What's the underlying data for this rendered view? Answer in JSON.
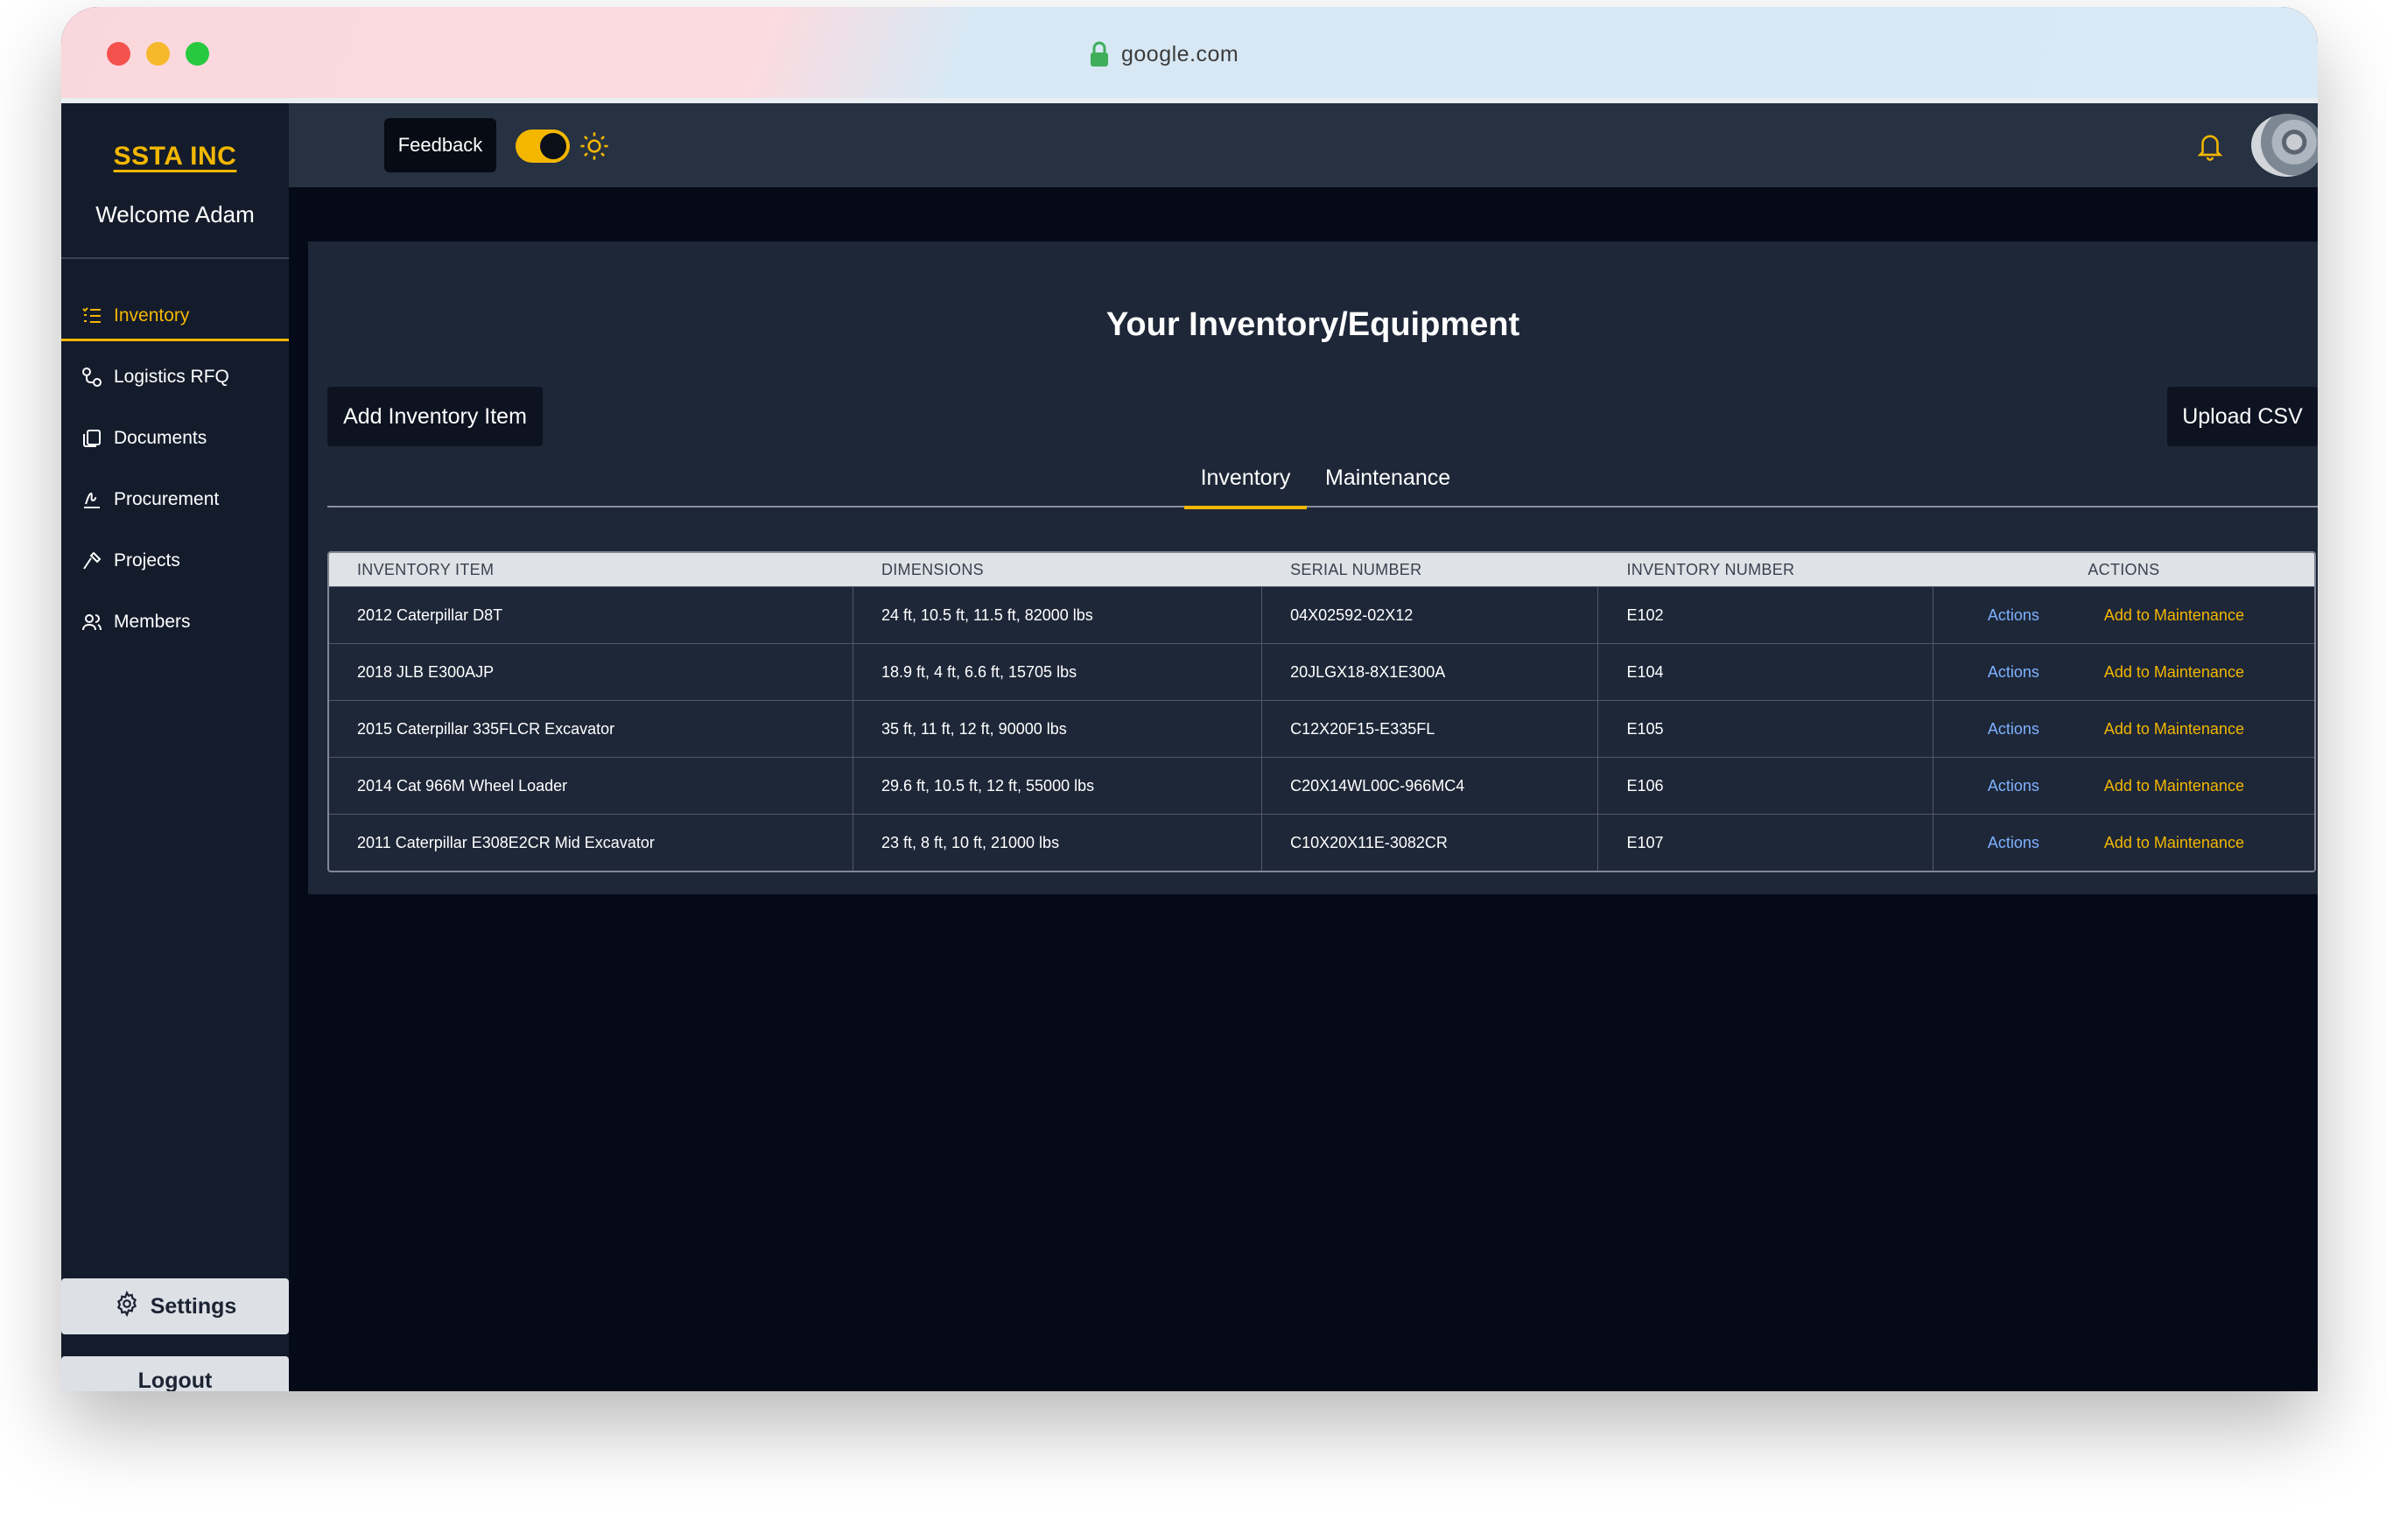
{
  "browser": {
    "url": "google.com",
    "colors": {
      "close": "#f5524e",
      "minimize": "#f6b82b",
      "maximize": "#27c93f"
    }
  },
  "sidebar": {
    "brand": "SSTA INC",
    "welcome": "Welcome Adam",
    "items": [
      {
        "label": "Inventory",
        "icon": "list-icon",
        "active": true
      },
      {
        "label": "Logistics RFQ",
        "icon": "route-icon",
        "active": false
      },
      {
        "label": "Documents",
        "icon": "documents-icon",
        "active": false
      },
      {
        "label": "Procurement",
        "icon": "signature-icon",
        "active": false
      },
      {
        "label": "Projects",
        "icon": "hammer-icon",
        "active": false
      },
      {
        "label": "Members",
        "icon": "users-icon",
        "active": false
      }
    ],
    "settings_label": "Settings",
    "logout_label": "Logout"
  },
  "header": {
    "feedback_label": "Feedback",
    "theme_toggle_on": true,
    "icons": [
      "sun-icon",
      "bell-icon",
      "avatar"
    ]
  },
  "main": {
    "title": "Your Inventory/Equipment",
    "add_button": "Add Inventory Item",
    "upload_button": "Upload CSV",
    "tabs": [
      {
        "label": "Inventory",
        "active": true
      },
      {
        "label": "Maintenance",
        "active": false
      }
    ],
    "table": {
      "columns": [
        "INVENTORY ITEM",
        "DIMENSIONS",
        "SERIAL NUMBER",
        "INVENTORY NUMBER",
        "ACTIONS"
      ],
      "rows": [
        {
          "item": "2012 Caterpillar D8T",
          "dimensions": "24 ft, 10.5 ft, 11.5 ft, 82000 lbs",
          "serial": "04X02592-02X12",
          "number": "E102",
          "actions": "Actions",
          "maintenance": "Add to Maintenance"
        },
        {
          "item": "2018 JLB E300AJP",
          "dimensions": "18.9 ft, 4 ft, 6.6 ft, 15705 lbs",
          "serial": "20JLGX18-8X1E300A",
          "number": "E104",
          "actions": "Actions",
          "maintenance": "Add to Maintenance"
        },
        {
          "item": "2015 Caterpillar 335FLCR Excavator",
          "dimensions": "35 ft, 11 ft, 12 ft, 90000 lbs",
          "serial": "C12X20F15-E335FL",
          "number": "E105",
          "actions": "Actions",
          "maintenance": "Add to Maintenance"
        },
        {
          "item": "2014 Cat 966M Wheel Loader",
          "dimensions": "29.6 ft, 10.5 ft, 12 ft, 55000 lbs",
          "serial": "C20X14WL00C-966MC4",
          "number": "E106",
          "actions": "Actions",
          "maintenance": "Add to Maintenance"
        },
        {
          "item": "2011 Caterpillar E308E2CR Mid Excavator",
          "dimensions": "23 ft, 8 ft, 10 ft, 21000 lbs",
          "serial": "C10X20X11E-3082CR",
          "number": "E107",
          "actions": "Actions",
          "maintenance": "Add to Maintenance"
        }
      ]
    }
  },
  "colors": {
    "accent": "#f3b700",
    "link": "#7eb1ff",
    "sidebar_bg": "#141c2c",
    "panel_bg": "#1e2738",
    "page_bg": "#040a18"
  }
}
